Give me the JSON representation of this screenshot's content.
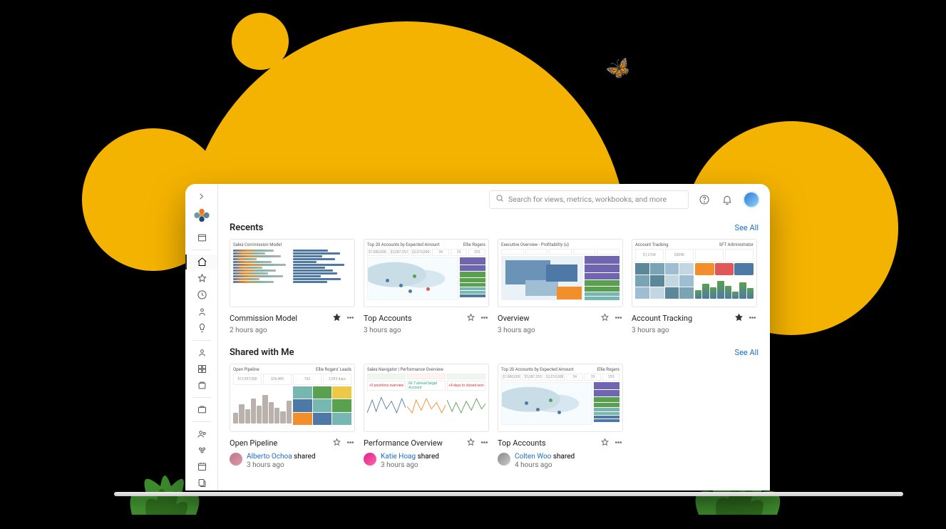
{
  "search": {
    "placeholder": "Search for views, metrics, workbooks, and more"
  },
  "sections": {
    "recents": {
      "title": "Recents",
      "see_all": "See All"
    },
    "shared": {
      "title": "Shared with Me",
      "see_all": "See All"
    }
  },
  "recents": [
    {
      "title": "Commission Model",
      "subtitle": "2 hours ago",
      "starred": true,
      "thumb_title": "Sales Commission Model"
    },
    {
      "title": "Top Accounts",
      "subtitle": "3 hours ago",
      "starred": false,
      "thumb_title": "Top 20 Accounts by Expected Amount",
      "thumb_owner": "Ellie Rogers"
    },
    {
      "title": "Overview",
      "subtitle": "3 hours ago",
      "starred": false,
      "thumb_title": "Executive Overview - Profitability (u)"
    },
    {
      "title": "Account Tracking",
      "subtitle": "3 hours ago",
      "starred": true,
      "thumb_title": "Account Tracking",
      "thumb_badge": "SFT Administrator",
      "thumb_kpi1": "$1,276K",
      "thumb_kpi2": "$509K"
    }
  ],
  "shared": [
    {
      "title": "Open Pipeline",
      "starred": false,
      "thumb_title": "Open Pipeline",
      "thumb_owner": "Ellie Rogers' Leads",
      "kpi": [
        "$12,957,000",
        "$36,489",
        "762",
        "2,593 days"
      ],
      "by": "Alberto Ochoa",
      "action": "shared",
      "when": "3 hours ago"
    },
    {
      "title": "Performance Overview",
      "starred": false,
      "thumb_title": "Sales Navigator | Performance Overview",
      "tiles": [
        "+5 positions overview",
        "66.7 annual target Account",
        "+4 days to closed won"
      ],
      "by": "Katie Hoag",
      "action": "shared",
      "when": "3 hours ago"
    },
    {
      "title": "Top Accounts",
      "starred": false,
      "thumb_title": "Top 20 Accounts by Expected Amount",
      "thumb_owner": "Ellie Rogers",
      "by": "Colten Woo",
      "action": "shared",
      "when": "4 hours ago"
    }
  ],
  "labels": {
    "shared_verb": "shared"
  }
}
